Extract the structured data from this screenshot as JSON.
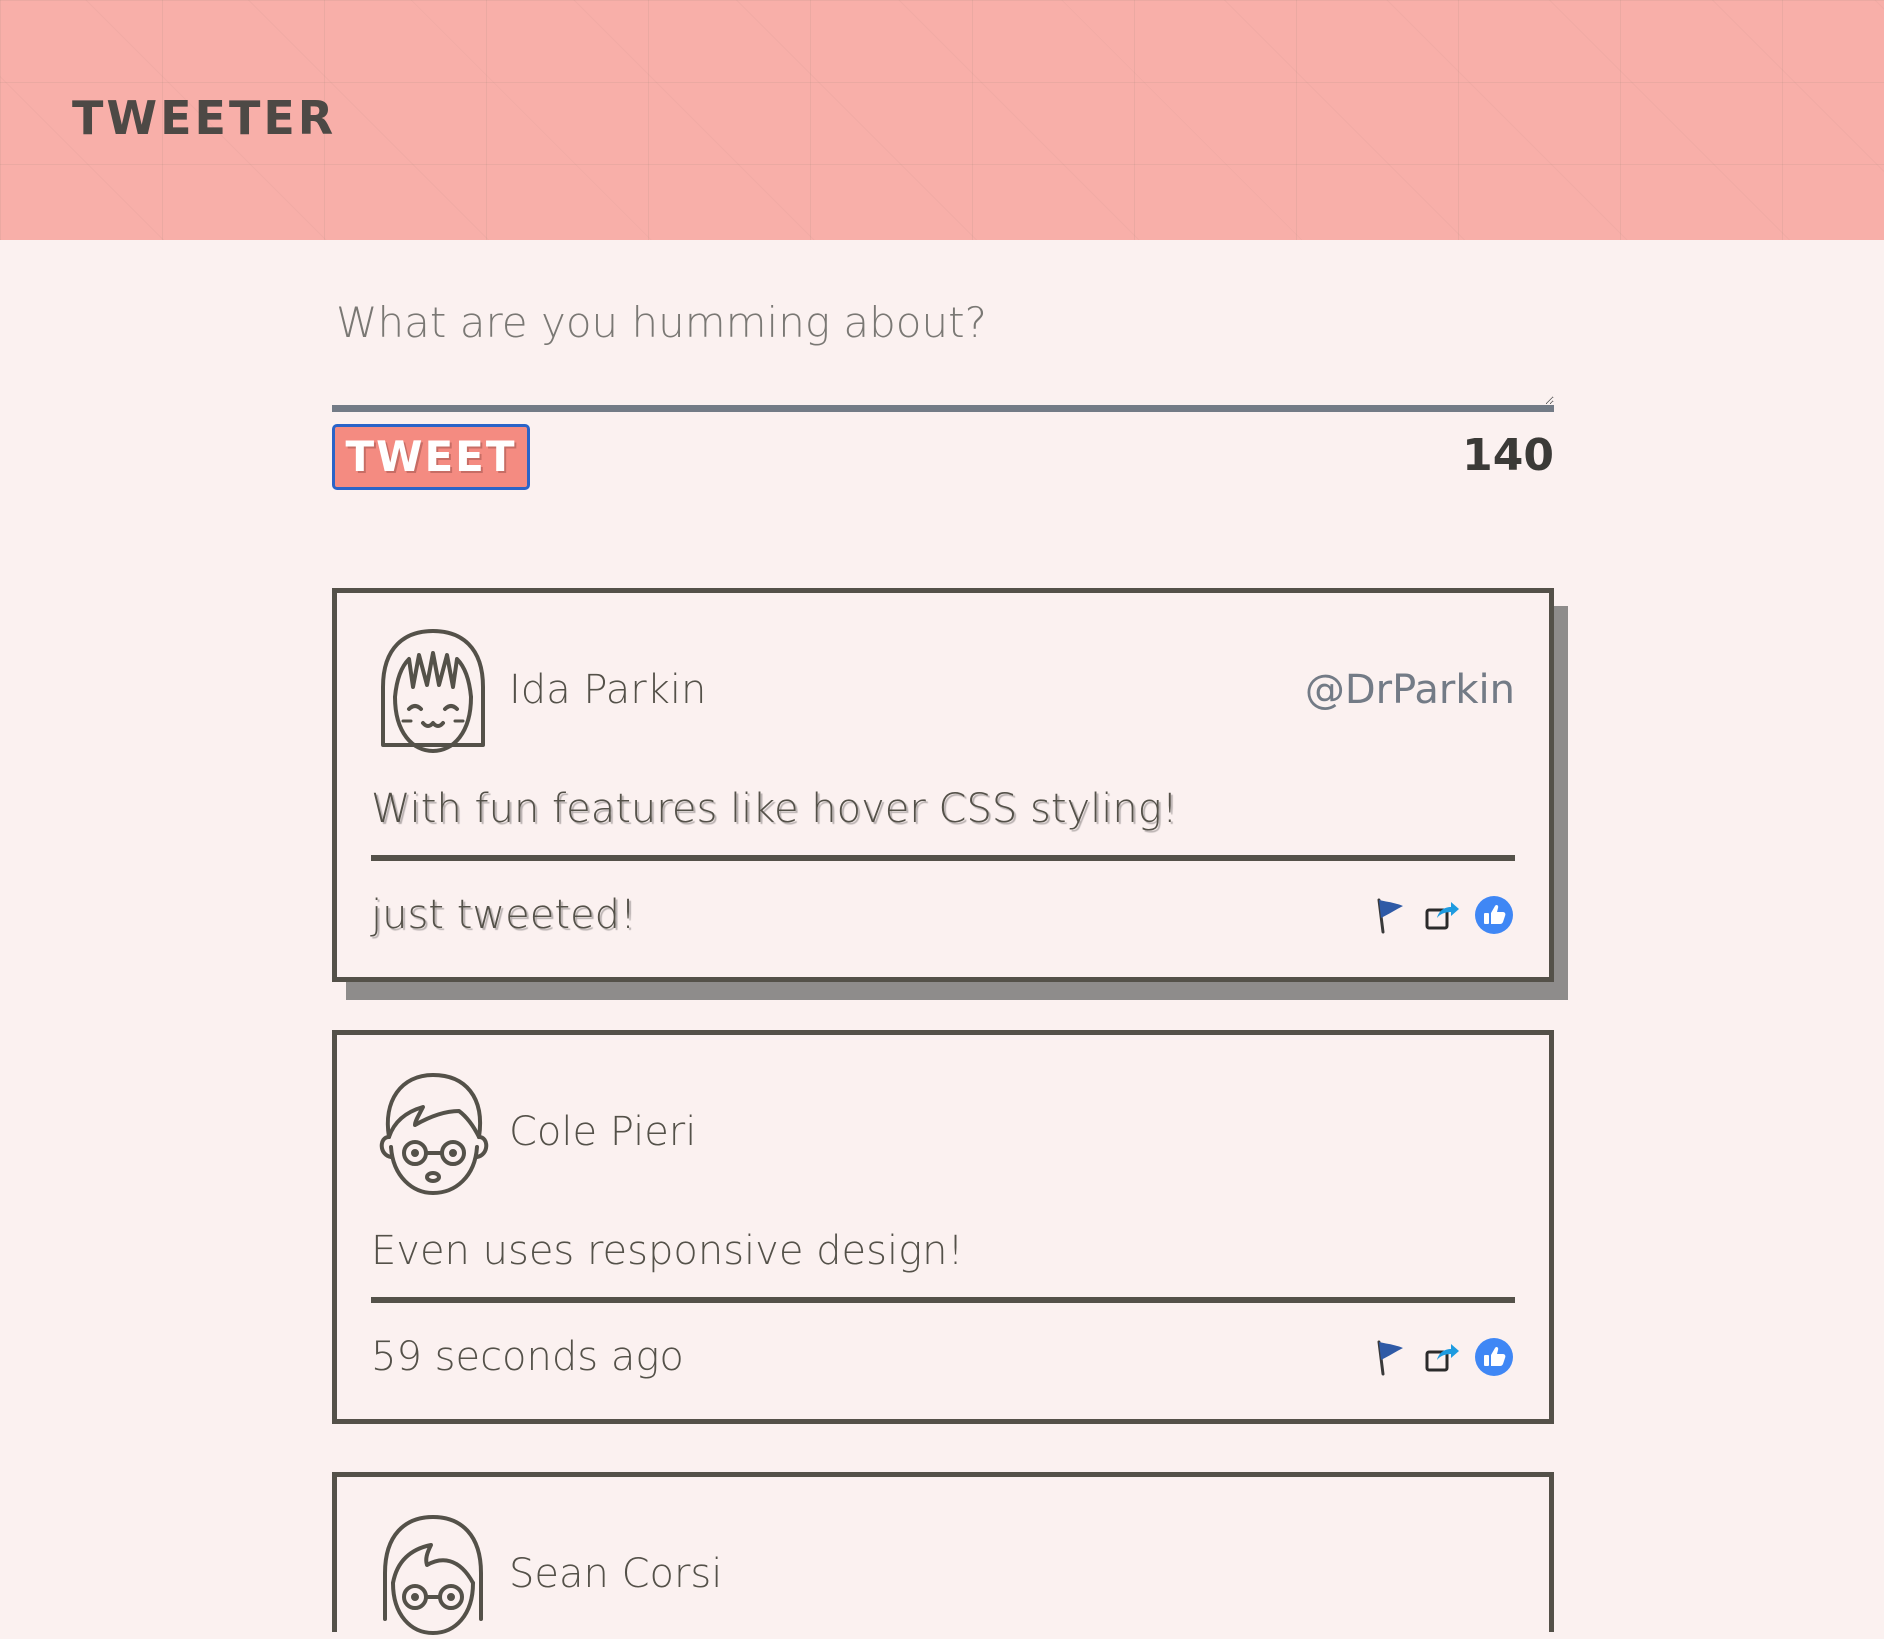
{
  "app": {
    "brand": "TWEETER"
  },
  "composer": {
    "placeholder": "What are you humming about?",
    "value": "",
    "button_label": "TWEET",
    "char_count": "140"
  },
  "colors": {
    "header_bg": "#f8afa9",
    "page_bg": "#fbf1f0",
    "button_bg": "#f48b81",
    "button_border": "#2b64c8",
    "text": "#545149",
    "handle": "#737b86",
    "like_blue": "#3f87f5"
  },
  "tweets": [
    {
      "name": "Ida Parkin",
      "handle": "@DrParkin",
      "content": "With fun features like hover CSS styling!",
      "footer": "just tweeted!",
      "avatar_icon": "girl-bangs-avatar-icon",
      "actions": [
        "flag-icon",
        "share-icon",
        "like-icon"
      ]
    },
    {
      "name": "Cole Pieri",
      "handle": "",
      "content": "Even uses responsive design!",
      "footer": "59 seconds ago",
      "avatar_icon": "boy-glasses-avatar-icon",
      "actions": [
        "flag-icon",
        "share-icon",
        "like-icon"
      ]
    },
    {
      "name": "Sean Corsi",
      "handle": "",
      "content": "",
      "footer": "",
      "avatar_icon": "girl-glasses-avatar-icon",
      "actions": []
    }
  ]
}
